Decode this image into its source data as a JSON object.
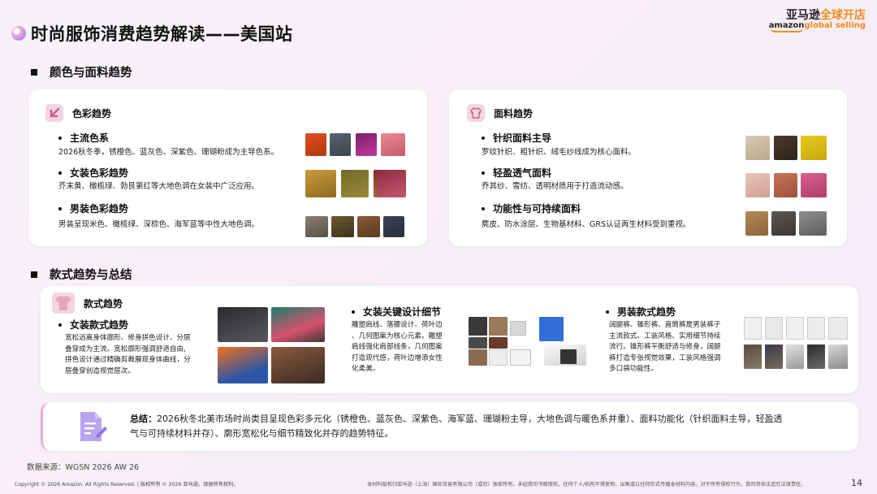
{
  "header": {
    "title": "时尚服饰消费趋势解读——美国站",
    "brand_cn_prefix": "亚马逊",
    "brand_cn_suffix": "全球开店",
    "brand_en_prefix": "amazon",
    "brand_en_suffix": "global selling"
  },
  "sections": {
    "color_fabric": "颜色与面料趋势",
    "style_summary": "款式趋势与总结"
  },
  "color_card": {
    "title": "色彩趋势",
    "items": [
      {
        "head": "主流色系",
        "text": "2026秋冬季，锈橙色、蓝灰色、深紫色、珊瑚粉成为主导色系。"
      },
      {
        "head": "女装色彩趋势",
        "text": "芥末黄、橄榄绿、勃艮第红等大地色调在女装中广泛应用。"
      },
      {
        "head": "男装色彩趋势",
        "text": "男装呈现米色、橄榄绿、深棕色、海军蓝等中性大地色调。"
      }
    ]
  },
  "fabric_card": {
    "title": "面料趋势",
    "items": [
      {
        "head": "针织面料主导",
        "text": "罗纹针织、粗针织、绒毛纱线成为核心面料。"
      },
      {
        "head": "轻盈透气面料",
        "text": "乔其纱、雪纺、透明材质用于打造流动感。"
      },
      {
        "head": "功能性与可持续面料",
        "text": "麂皮、防水涂层、生物基材料、GRS认证再生材料受到重视。"
      }
    ]
  },
  "style_card": {
    "title": "款式趋势",
    "col1": {
      "head": "女装款式趋势",
      "lines": [
        "宽松远离身体廓形、修身拼色设计、分层",
        "叠穿成为主流。宽松廓形强调舒适自由,",
        "拼色设计通过精确剪裁展现身体曲线，分",
        "层叠穿创造视觉层次。"
      ]
    },
    "col2": {
      "head": "女装关键设计细节",
      "lines": [
        "雕塑肩线、落腰设计、荷叶边",
        "、几何图案为核心元素。雕塑",
        "肩线强化肩部线条，几何图案",
        "打造现代感，荷叶边增添女性",
        "化柔美。"
      ]
    },
    "col3": {
      "head": "男装款式趋势",
      "lines": [
        "阔腿裤、锥形裤、直筒裤是男装裤子",
        "主流款式。工装风格、实用细节持续",
        "流行。锥形裤平衡舒适与修身，阔腿",
        "裤打造专张视觉效果，工装风格强调",
        "多口袋功能性。"
      ]
    }
  },
  "summary": {
    "label": "总结：",
    "line1": "2026秋冬北美市场时尚类目呈现色彩多元化（锈橙色、蓝灰色、深紫色、海军蓝、珊瑚粉主导，大地色调与暖色系并重）、面料功能化（针织面料主导，轻盈透",
    "line2": "气与可持续材料并存）、廓形宽松化与细节精致化并存的趋势特征。"
  },
  "footer": {
    "source": "数据来源：WGSN 2026 AW 26",
    "copyright": "Copyright © 2026 Amazon. All Rights Reserved.  |  版权所有 © 2026 亚马逊。保留所有权利。",
    "notice": "本材料版权归亚马逊（上海）国际贸易有限公司（或司）独家所有。未经我司书面授权，任何个人/机构不得复制、出售或以任何形式传播本材料内容。对于所有侵权行为，我司将依法追究法律责任。",
    "page": "14"
  },
  "colors": {
    "badge_bg": "#f3d5e3",
    "accent_pink": "#c9607f",
    "brand_orange": "#f08a1c"
  },
  "icons": {
    "color": "arrow-down-left-icon",
    "fabric": "sweater-icon",
    "style": "tshirt-icon",
    "summary": "document-pen-icon"
  }
}
